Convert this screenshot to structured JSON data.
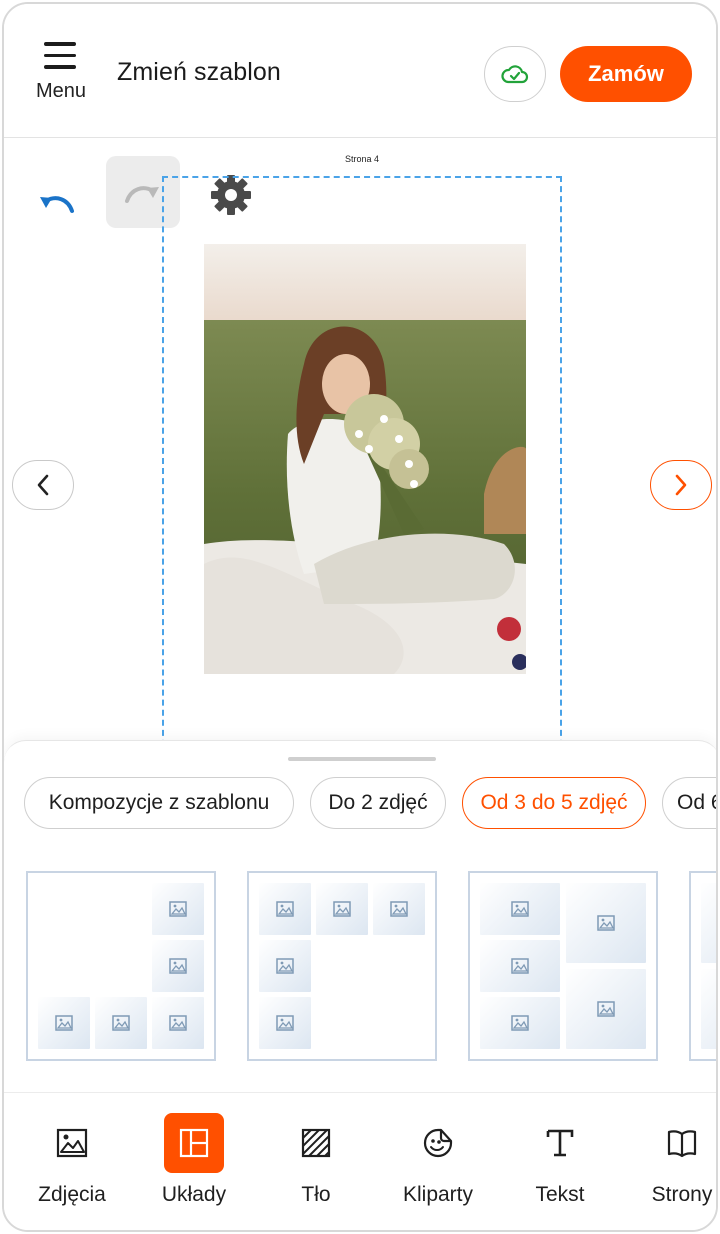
{
  "header": {
    "menu_label": "Menu",
    "title": "Zmień szablon",
    "order_label": "Zamów"
  },
  "canvas": {
    "page_label": "Strona 4"
  },
  "sheet": {
    "chips": [
      {
        "label": "Kompozycje z szablonu",
        "active": false
      },
      {
        "label": "Do 2 zdjęć",
        "active": false
      },
      {
        "label": "Od 3 do 5 zdjęć",
        "active": true
      },
      {
        "label": "Od 6",
        "active": false
      }
    ]
  },
  "toolbar": {
    "items": [
      {
        "label": "Zdjęcia",
        "icon": "image-icon"
      },
      {
        "label": "Układy",
        "icon": "layout-icon",
        "active": true
      },
      {
        "label": "Tło",
        "icon": "background-icon"
      },
      {
        "label": "Kliparty",
        "icon": "sticker-icon"
      },
      {
        "label": "Tekst",
        "icon": "text-icon"
      },
      {
        "label": "Strony",
        "icon": "book-icon"
      }
    ]
  },
  "colors": {
    "accent": "#ff5000",
    "undo": "#1a73c8",
    "cloud": "#22a33a",
    "frame_dash": "#4aa3e8"
  }
}
